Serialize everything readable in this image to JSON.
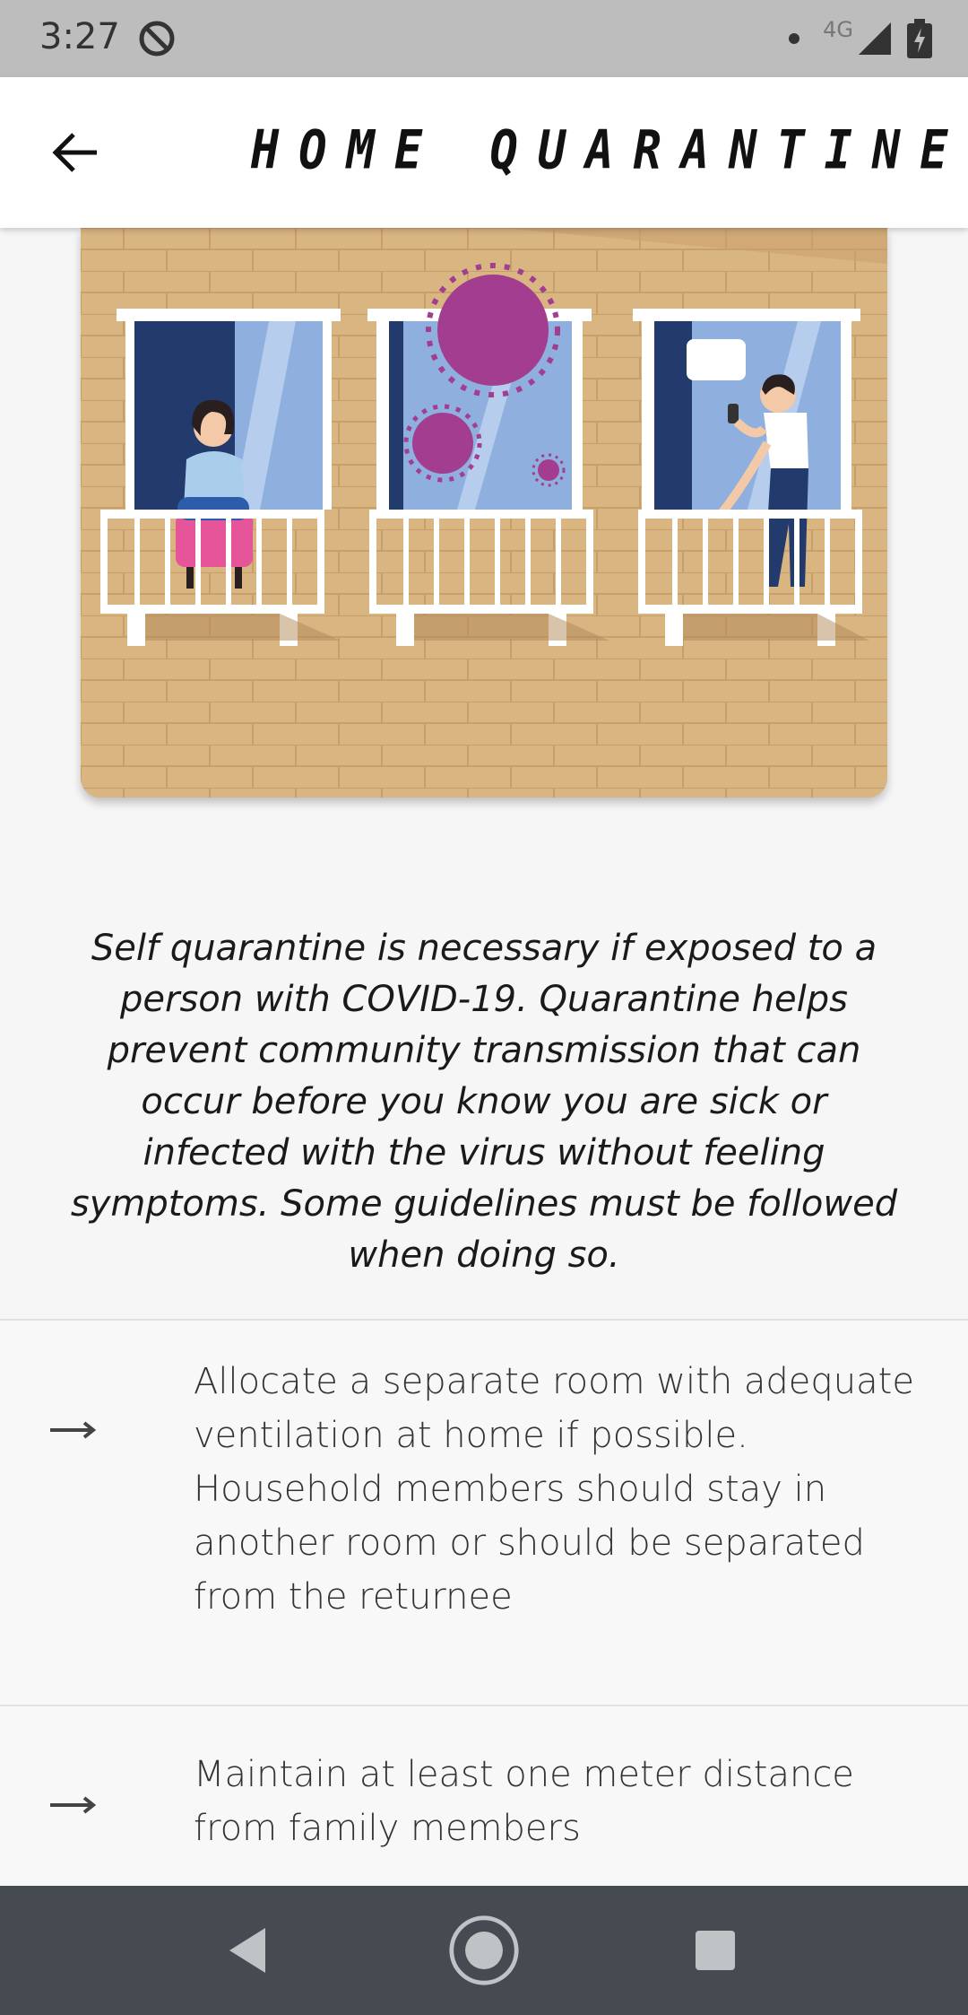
{
  "status_bar": {
    "time": "3:27",
    "network": "4G",
    "icons": [
      "do-not-disturb-icon",
      "dot-icon",
      "signal-icon",
      "battery-charging-icon"
    ]
  },
  "app_bar": {
    "title": "HOME QUARANTINE",
    "back_icon": "arrow-left-icon"
  },
  "illustration": {
    "description_icon": "quarantine-balconies-illustration",
    "colors": {
      "brick": "#d9b582",
      "frame": "#ffffff",
      "glass": "#8fb0de",
      "dark_glass": "#233a6d",
      "virus": "#a23d8f",
      "chair": "#e6559a"
    }
  },
  "intro": {
    "text": "Self quarantine is necessary if exposed to a person with COVID-19. Quarantine helps prevent community transmission that can occur before you know you are sick or infected with the virus without feeling symptoms. Some guidelines must be followed when doing so."
  },
  "guidelines": [
    {
      "icon": "arrow-right-icon",
      "text": "Allocate a separate room with adequate ventilation at home if possible. Household members should stay in another room or should be separated from the returnee"
    },
    {
      "icon": "arrow-right-icon",
      "text": "Maintain at least one meter distance from family members"
    }
  ],
  "nav_bar": {
    "icons": [
      "nav-back-icon",
      "nav-home-icon",
      "nav-recents-icon"
    ]
  }
}
